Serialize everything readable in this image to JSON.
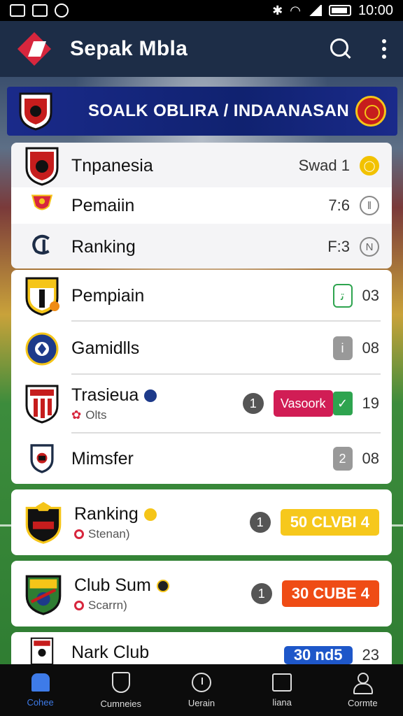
{
  "status_bar": {
    "time": "10:00"
  },
  "app_bar": {
    "title": "Sepak Mbla"
  },
  "banner": {
    "title": "SOALK OBLIRA / INDAANASAN"
  },
  "rows": [
    {
      "name": "Tnpanesia",
      "score": "Swad 1"
    },
    {
      "name": "Pemaiin",
      "score": "7:6"
    },
    {
      "name": "Ranking",
      "score": "F:3"
    },
    {
      "name": "Pempiain",
      "badge": "ﺗ",
      "score": "03"
    },
    {
      "name": "Gamidlls",
      "badge": "i",
      "score": "08"
    },
    {
      "name": "Trasieua",
      "sub": "Olts",
      "num": "1",
      "pill": "Vasoork",
      "check": "✓",
      "score": "19"
    },
    {
      "name": "Mimsfer",
      "badge": "2",
      "score": "08"
    },
    {
      "name": "Ranking",
      "sub": "Stenan)",
      "num": "1",
      "pill": "50 CLVBI  4"
    },
    {
      "name": "Club Sum",
      "sub": "Scarrn)",
      "num": "1",
      "pill": "30 CUBE  4"
    },
    {
      "name": "Nark Club",
      "pill": "30 nd5",
      "score": "23"
    }
  ],
  "bottom_nav": [
    {
      "label": "Cohee"
    },
    {
      "label": "Cumneies"
    },
    {
      "label": "Uerain"
    },
    {
      "label": "liana"
    },
    {
      "label": "Cormte"
    }
  ],
  "colors": {
    "app_bar": "#1d2d47",
    "banner": "#102270",
    "accent_blue": "#3e7be8",
    "pill_yellow": "#f6c81c",
    "pill_orange": "#ef4c15",
    "pill_red": "#d11d55",
    "green": "#2ea44f"
  }
}
